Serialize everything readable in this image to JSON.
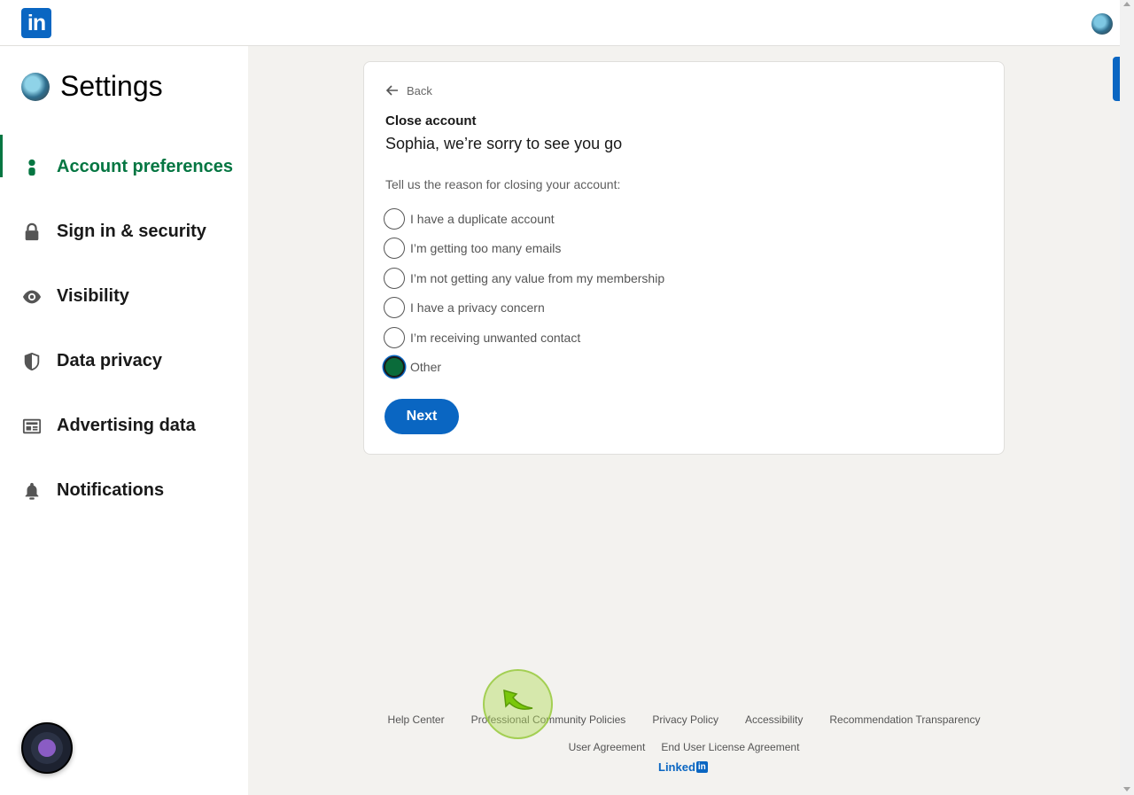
{
  "topbar": {
    "logo_text": "in"
  },
  "sidebar": {
    "title": "Settings",
    "items": [
      {
        "label": "Account preferences",
        "icon": "person-icon",
        "active": true
      },
      {
        "label": "Sign in & security",
        "icon": "lock-icon",
        "active": false
      },
      {
        "label": "Visibility",
        "icon": "eye-icon",
        "active": false
      },
      {
        "label": "Data privacy",
        "icon": "shield-icon",
        "active": false
      },
      {
        "label": "Advertising data",
        "icon": "newspaper-icon",
        "active": false
      },
      {
        "label": "Notifications",
        "icon": "bell-icon",
        "active": false
      }
    ]
  },
  "card": {
    "back_label": "Back",
    "title": "Close account",
    "subtitle": "Sophia, we’re sorry to see you go",
    "prompt": "Tell us the reason for closing your account:",
    "options": [
      {
        "label": "I have a duplicate account",
        "checked": false
      },
      {
        "label": "I’m getting too many emails",
        "checked": false
      },
      {
        "label": "I’m not getting any value from my membership",
        "checked": false
      },
      {
        "label": "I have a privacy concern",
        "checked": false
      },
      {
        "label": "I’m receiving unwanted contact",
        "checked": false
      },
      {
        "label": "Other",
        "checked": true
      }
    ],
    "next_label": "Next"
  },
  "footer": {
    "row1": [
      "Help Center",
      "Professional Community Policies",
      "Privacy Policy",
      "Accessibility",
      "Recommendation Transparency"
    ],
    "row2": [
      "User Agreement",
      "End User License Agreement"
    ],
    "brand_text": "Linked",
    "brand_box": "in"
  },
  "colors": {
    "brand": "#0a66c2",
    "active_nav": "#057642",
    "selected_radio": "#0a6b3a"
  }
}
